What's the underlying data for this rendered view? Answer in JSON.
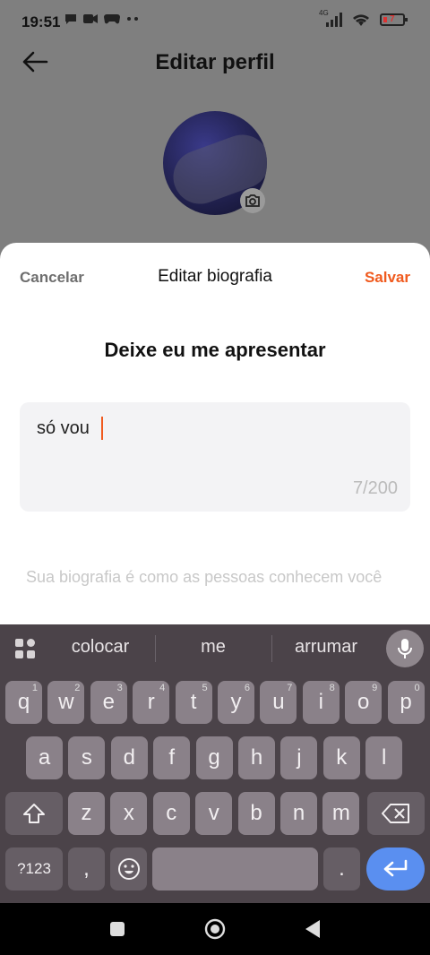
{
  "status": {
    "time": "19:51",
    "network": "4G",
    "battery": "7"
  },
  "header": {
    "title": "Editar perfil"
  },
  "sheet": {
    "cancel_label": "Cancelar",
    "title": "Editar biografia",
    "save_label": "Salvar",
    "prompt": "Deixe eu me apresentar",
    "bio_value": "só vou",
    "counter": "7/200",
    "helper": "Sua biografia é como as pessoas conhecem você"
  },
  "keyboard": {
    "suggestions": [
      "colocar",
      "me",
      "arrumar"
    ],
    "row1": [
      {
        "k": "q",
        "n": "1"
      },
      {
        "k": "w",
        "n": "2"
      },
      {
        "k": "e",
        "n": "3"
      },
      {
        "k": "r",
        "n": "4"
      },
      {
        "k": "t",
        "n": "5"
      },
      {
        "k": "y",
        "n": "6"
      },
      {
        "k": "u",
        "n": "7"
      },
      {
        "k": "i",
        "n": "8"
      },
      {
        "k": "o",
        "n": "9"
      },
      {
        "k": "p",
        "n": "0"
      }
    ],
    "row2": [
      "a",
      "s",
      "d",
      "f",
      "g",
      "h",
      "j",
      "k",
      "l"
    ],
    "row3": [
      "z",
      "x",
      "c",
      "v",
      "b",
      "n",
      "m"
    ],
    "symbols_label": "?123",
    "comma_label": ",",
    "period_label": "."
  },
  "colors": {
    "accent": "#f05a1e",
    "enter": "#5a8ff0"
  }
}
